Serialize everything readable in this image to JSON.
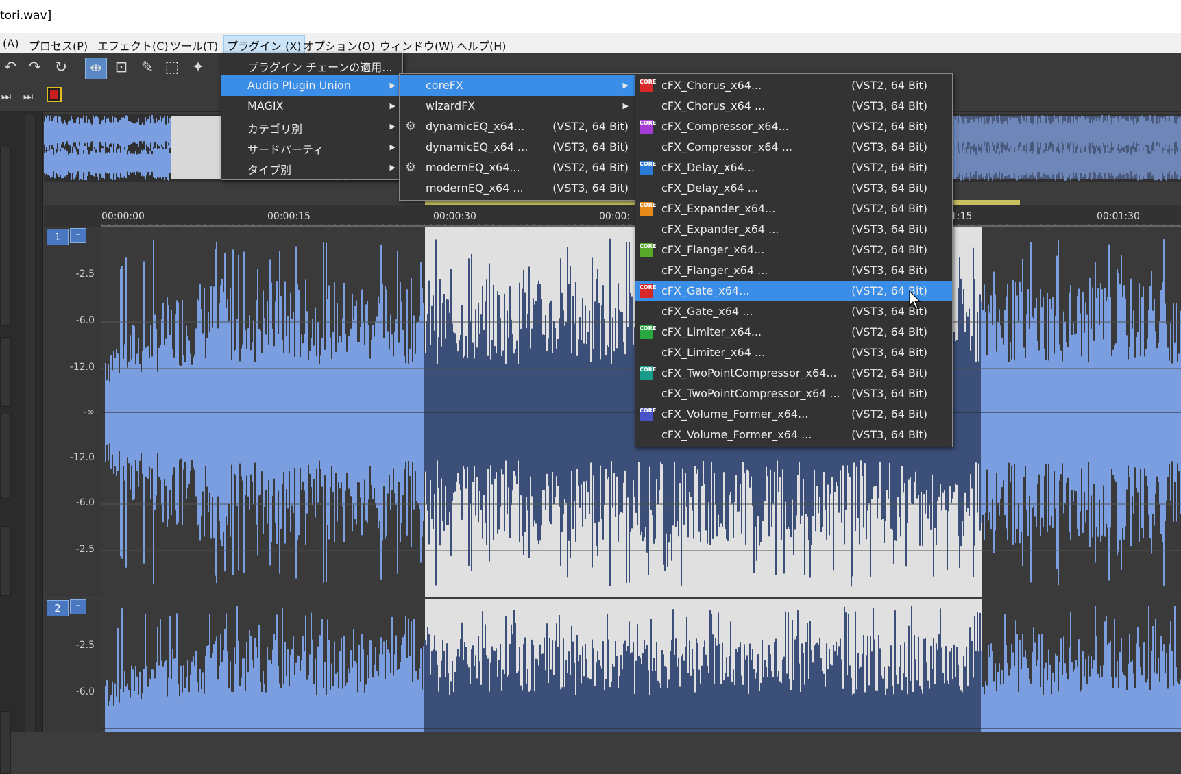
{
  "window": {
    "title": "tori.wav]"
  },
  "menubar": [
    "(A)",
    "プロセス(P)",
    "エフェクト(C)",
    "ツール(T)",
    "プラグイン (X)",
    "オプション(O)",
    "ウィンドウ(W)",
    "ヘルプ(H)"
  ],
  "ruler": {
    "ticks": [
      "00:00:00",
      "00:00:15",
      "00:00:30",
      "00:00:",
      "1:15",
      "00:01:30"
    ]
  },
  "track1": {
    "number": "1",
    "db_labels": [
      "-2.5",
      "-6.0",
      "-12.0",
      "-∞",
      "-12.0",
      "-6.0",
      "-2.5"
    ]
  },
  "track2": {
    "number": "2",
    "db_labels": [
      "-2.5",
      "-6.0"
    ]
  },
  "plugin_menu": {
    "items": [
      {
        "label": "プラグイン チェーンの適用...",
        "has_submenu": false,
        "highlighted": false
      },
      {
        "label": "Audio Plugin Union",
        "has_submenu": true,
        "highlighted": true
      },
      {
        "label": "MAGIX",
        "has_submenu": true,
        "highlighted": false
      },
      {
        "label": "カテゴリ別",
        "has_submenu": true,
        "highlighted": false
      },
      {
        "label": "サードパーティ",
        "has_submenu": true,
        "highlighted": false
      },
      {
        "label": "タイプ別",
        "has_submenu": true,
        "highlighted": false
      }
    ]
  },
  "apu_submenu": {
    "items": [
      {
        "label": "coreFX",
        "sub": "",
        "has_submenu": true,
        "highlighted": true,
        "icon": ""
      },
      {
        "label": "wizardFX",
        "sub": "",
        "has_submenu": true,
        "highlighted": false,
        "icon": ""
      },
      {
        "label": "dynamicEQ_x64...",
        "sub": "(VST2, 64 Bit)",
        "has_submenu": false,
        "highlighted": false,
        "icon": "gear-icon"
      },
      {
        "label": "dynamicEQ_x64 ...",
        "sub": "(VST3, 64 Bit)",
        "has_submenu": false,
        "highlighted": false,
        "icon": ""
      },
      {
        "label": "modernEQ_x64...",
        "sub": "(VST2, 64 Bit)",
        "has_submenu": false,
        "highlighted": false,
        "icon": "gear-icon"
      },
      {
        "label": "modernEQ_x64 ...",
        "sub": "(VST3, 64 Bit)",
        "has_submenu": false,
        "highlighted": false,
        "icon": ""
      }
    ]
  },
  "corefx_submenu": {
    "items": [
      {
        "label": "cFX_Chorus_x64...",
        "sub": "(VST2, 64 Bit)",
        "icon_color": "#d62828",
        "highlighted": false
      },
      {
        "label": "cFX_Chorus_x64 ...",
        "sub": "(VST3, 64 Bit)",
        "icon_color": "",
        "highlighted": false
      },
      {
        "label": "cFX_Compressor_x64...",
        "sub": "(VST2, 64 Bit)",
        "icon_color": "#a43cd4",
        "highlighted": false
      },
      {
        "label": "cFX_Compressor_x64 ...",
        "sub": "(VST3, 64 Bit)",
        "icon_color": "",
        "highlighted": false
      },
      {
        "label": "cFX_Delay_x64...",
        "sub": "(VST2, 64 Bit)",
        "icon_color": "#2a7ad8",
        "highlighted": false
      },
      {
        "label": "cFX_Delay_x64 ...",
        "sub": "(VST3, 64 Bit)",
        "icon_color": "",
        "highlighted": false
      },
      {
        "label": "cFX_Expander_x64...",
        "sub": "(VST2, 64 Bit)",
        "icon_color": "#e88a1a",
        "highlighted": false
      },
      {
        "label": "cFX_Expander_x64 ...",
        "sub": "(VST3, 64 Bit)",
        "icon_color": "",
        "highlighted": false
      },
      {
        "label": "cFX_Flanger_x64...",
        "sub": "(VST2, 64 Bit)",
        "icon_color": "#58a82a",
        "highlighted": false
      },
      {
        "label": "cFX_Flanger_x64 ...",
        "sub": "(VST3, 64 Bit)",
        "icon_color": "",
        "highlighted": false
      },
      {
        "label": "cFX_Gate_x64...",
        "sub": "(VST2, 64 Bit)",
        "icon_color": "#d62828",
        "highlighted": true
      },
      {
        "label": "cFX_Gate_x64 ...",
        "sub": "(VST3, 64 Bit)",
        "icon_color": "",
        "highlighted": false
      },
      {
        "label": "cFX_Limiter_x64...",
        "sub": "(VST2, 64 Bit)",
        "icon_color": "#28a840",
        "highlighted": false
      },
      {
        "label": "cFX_Limiter_x64 ...",
        "sub": "(VST3, 64 Bit)",
        "icon_color": "",
        "highlighted": false
      },
      {
        "label": "cFX_TwoPointCompressor_x64...",
        "sub": "(VST2, 64 Bit)",
        "icon_color": "#1a9c8c",
        "highlighted": false
      },
      {
        "label": "cFX_TwoPointCompressor_x64 ...",
        "sub": "(VST3, 64 Bit)",
        "icon_color": "",
        "highlighted": false
      },
      {
        "label": "cFX_Volume_Former_x64...",
        "sub": "(VST2, 64 Bit)",
        "icon_color": "#4a52c8",
        "highlighted": false
      },
      {
        "label": "cFX_Volume_Former_x64 ...",
        "sub": "(VST3, 64 Bit)",
        "icon_color": "",
        "highlighted": false
      }
    ],
    "icon_text": "CORE"
  },
  "colors": {
    "accent": "#3a8ee8",
    "waveform": "#7b9ee0",
    "waveform_dark": "#3c4f78",
    "selection": "#e0e0e0"
  }
}
